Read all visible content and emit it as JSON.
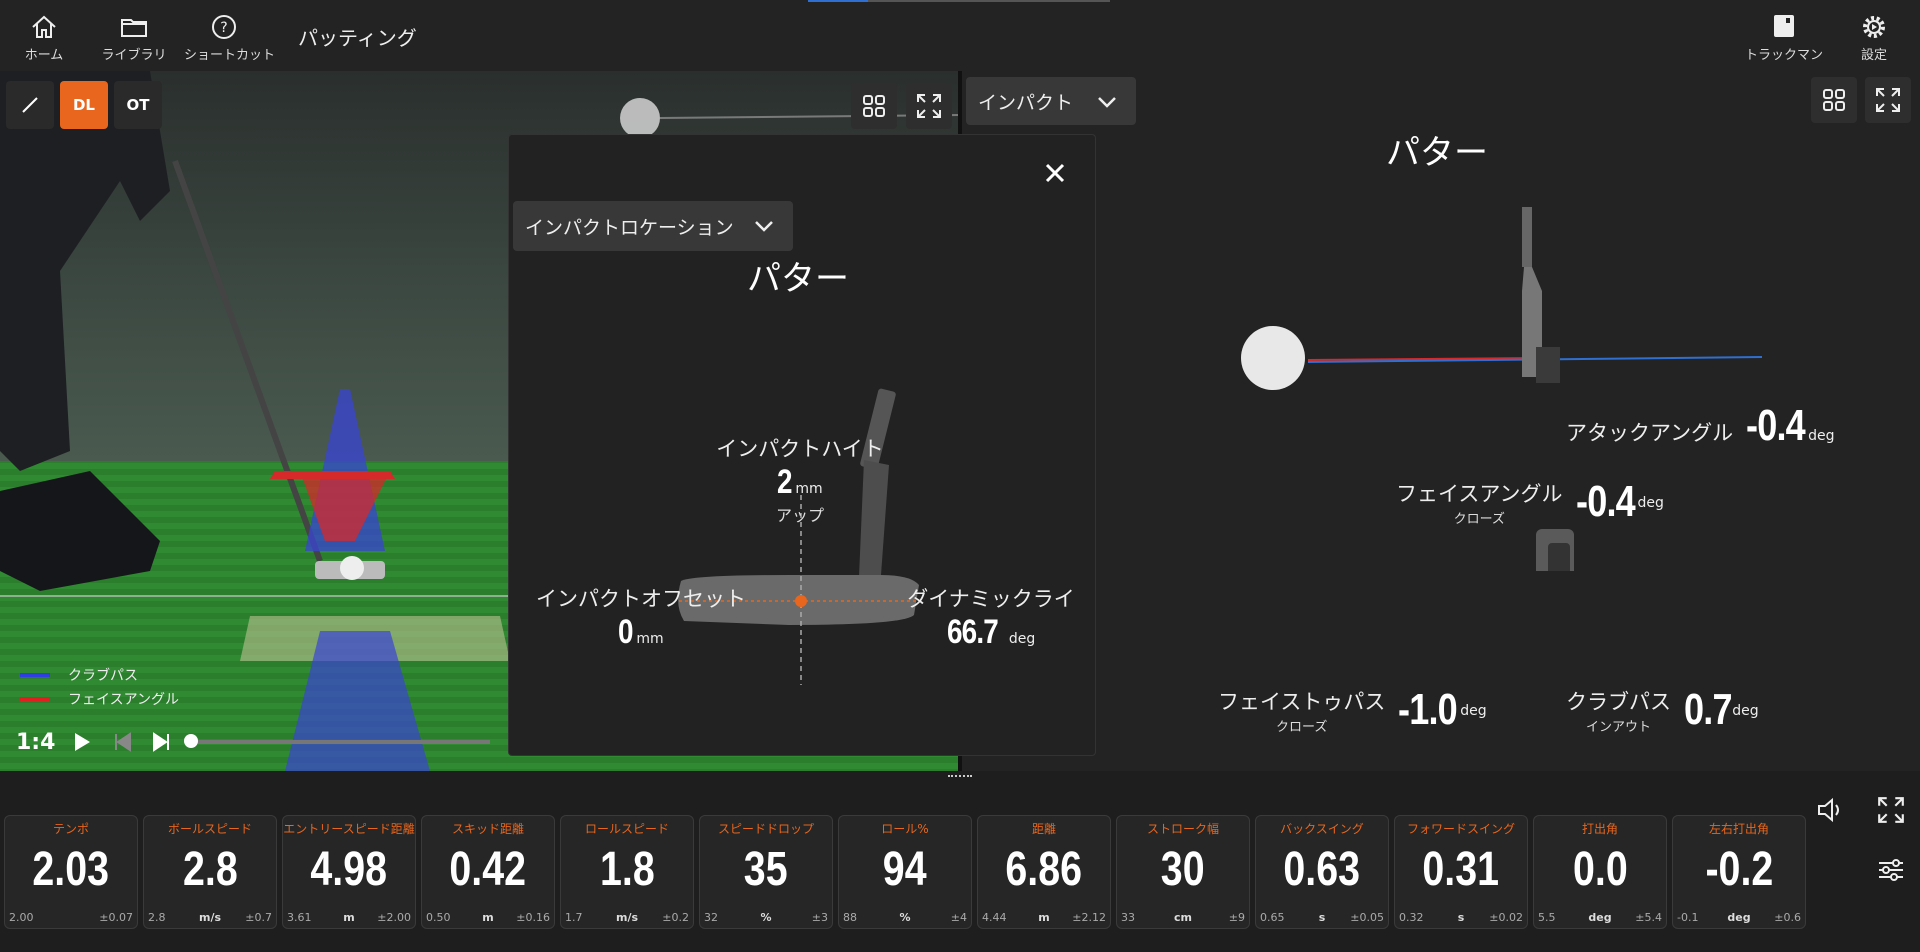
{
  "nav": {
    "home": "ホーム",
    "library": "ライブラリ",
    "shortcut": "ショートカット",
    "page_title": "パッティング",
    "trackman": "トラックマン",
    "settings": "設定"
  },
  "left": {
    "tools": {
      "dl": "DL",
      "ot": "OT"
    },
    "legend": {
      "club_path": "クラブパス",
      "face_angle": "フェイスアングル"
    },
    "playback_rate": "1:4",
    "playback_progress": 0
  },
  "modal": {
    "dropdown": "インパクトロケーション",
    "title": "パター",
    "impact_height_label": "インパクトハイト",
    "impact_height_value": "2",
    "impact_height_unit": "mm",
    "impact_height_dir": "アップ",
    "impact_offset_label": "インパクトオフセット",
    "impact_offset_value": "0",
    "impact_offset_unit": "mm",
    "dynamic_lie_label": "ダイナミックライ",
    "dynamic_lie_value": "66.7",
    "dynamic_lie_unit": "deg"
  },
  "right": {
    "dropdown": "インパクト",
    "title": "パター",
    "attack_angle_label": "アタックアングル",
    "attack_angle_value": "-0.4",
    "face_angle_label": "フェイスアングル",
    "face_angle_sub": "クローズ",
    "face_angle_value": "-0.4",
    "face_to_path_label": "フェイストゥパス",
    "face_to_path_sub": "クローズ",
    "face_to_path_value": "-1.0",
    "club_path_label": "クラブパス",
    "club_path_sub": "インアウト",
    "club_path_value": "0.7",
    "unit": "deg"
  },
  "colors": {
    "accent": "#e8661d",
    "club_path": "#2f6fd1",
    "face_angle": "#d62a2a"
  },
  "metrics": [
    {
      "title": "テンポ",
      "value": "2.03",
      "min": "2.00",
      "unit": "",
      "sd": "±0.07"
    },
    {
      "title": "ボールスピード",
      "value": "2.8",
      "min": "2.8",
      "unit": "m/s",
      "sd": "±0.7"
    },
    {
      "title": "エントリースピード距離",
      "value": "4.98",
      "min": "3.61",
      "unit": "m",
      "sd": "±2.00"
    },
    {
      "title": "スキッド距離",
      "value": "0.42",
      "min": "0.50",
      "unit": "m",
      "sd": "±0.16"
    },
    {
      "title": "ロールスピード",
      "value": "1.8",
      "min": "1.7",
      "unit": "m/s",
      "sd": "±0.2"
    },
    {
      "title": "スピードドロップ",
      "value": "35",
      "min": "32",
      "unit": "%",
      "sd": "±3"
    },
    {
      "title": "ロール%",
      "value": "94",
      "min": "88",
      "unit": "%",
      "sd": "±4"
    },
    {
      "title": "距離",
      "value": "6.86",
      "min": "4.44",
      "unit": "m",
      "sd": "±2.12"
    },
    {
      "title": "ストローク幅",
      "value": "30",
      "min": "33",
      "unit": "cm",
      "sd": "±9"
    },
    {
      "title": "バックスイング",
      "value": "0.63",
      "min": "0.65",
      "unit": "s",
      "sd": "±0.05"
    },
    {
      "title": "フォワードスイング",
      "value": "0.31",
      "min": "0.32",
      "unit": "s",
      "sd": "±0.02"
    },
    {
      "title": "打出角",
      "value": "0.0",
      "min": "5.5",
      "unit": "deg",
      "sd": "±5.4"
    },
    {
      "title": "左右打出角",
      "value": "-0.2",
      "min": "-0.1",
      "unit": "deg",
      "sd": "±0.6"
    }
  ]
}
